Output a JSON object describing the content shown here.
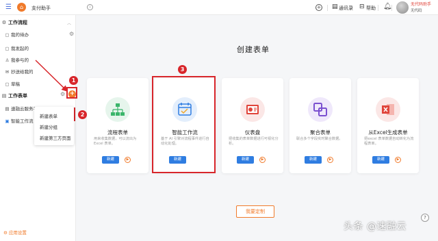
{
  "topbar": {
    "menu_icon": "list-icon",
    "home_icon": "home-icon",
    "title": "支付助手",
    "info_icon": "info-icon",
    "add_icon": "plus-circle-icon",
    "contacts_label": "通讯录",
    "help_label": "帮助",
    "bell_icon": "bell-icon",
    "user_name": "无代码助手",
    "company": "无代码"
  },
  "sidebar": {
    "workflow_section": "工作流程",
    "workflow_items": [
      {
        "label": "我的待办",
        "icon": "todo-icon"
      },
      {
        "label": "我发起的",
        "icon": "send-icon"
      },
      {
        "label": "我参与的",
        "icon": "user-icon"
      },
      {
        "label": "抄送给我的",
        "icon": "cc-icon"
      },
      {
        "label": "草稿",
        "icon": "draft-icon"
      }
    ],
    "forms_section": "工作表单",
    "form_items": [
      {
        "label": "速融云服务平…",
        "icon": "doc-icon"
      },
      {
        "label": "智能工作流",
        "icon": "workflow-icon"
      }
    ],
    "settings_label": "应用设置"
  },
  "dropdown": {
    "items": [
      "新建表单",
      "新建分组",
      "新建第三方页面"
    ]
  },
  "main": {
    "title": "创建表单",
    "cards": [
      {
        "title": "流程表单",
        "desc": "用来收集数据，可以流出为 Excel 表单。",
        "button": "新建",
        "icon": "flow-form-icon",
        "color": "#3bb56b"
      },
      {
        "title": "智能工作流",
        "desc": "基于 AI 引擎对流程事件进行自动化处理。",
        "button": "新建",
        "icon": "calendar-workflow-icon",
        "color": "#2f7de1"
      },
      {
        "title": "仪表盘",
        "desc": "把收集的表单数据进行可视化分析。",
        "button": "新建",
        "icon": "dashboard-icon",
        "color": "#e0443a"
      },
      {
        "title": "聚合表单",
        "desc": "联合多个字段实时聚合数据。",
        "button": "新建",
        "icon": "aggregate-icon",
        "color": "#7a4fd0"
      },
      {
        "title": "从Excel生成表单",
        "desc": "把excel 表单数据自动转化为流程表单。",
        "button": "新建",
        "icon": "excel-icon",
        "color": "#e0443a"
      }
    ],
    "custom_button": "我要定制"
  },
  "annotations": {
    "badge_1": "1",
    "badge_2": "2",
    "badge_3": "3"
  },
  "watermark": "头条 @速融云"
}
